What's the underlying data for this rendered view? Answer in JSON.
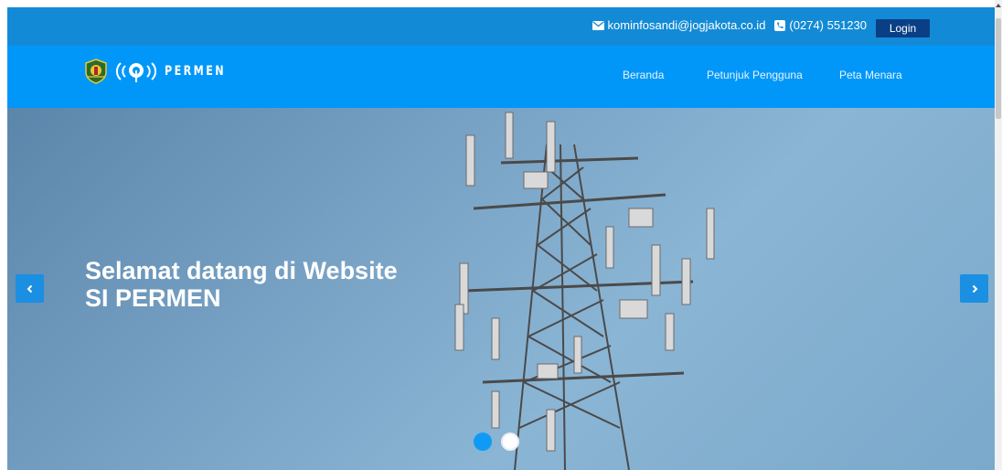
{
  "topbar": {
    "email": "kominfosandi@jogjakota.co.id",
    "phone": "(0274) 551230",
    "login_label": "Login"
  },
  "navbar": {
    "brand": "PERMEN",
    "items": [
      {
        "label": "Beranda"
      },
      {
        "label": "Petunjuk Pengguna"
      },
      {
        "label": "Peta Menara"
      }
    ]
  },
  "hero": {
    "title_line1": "Selamat datang di Website",
    "title_line2": "SI PERMEN"
  },
  "carousel": {
    "slide_count": 2,
    "active_index": 0
  },
  "colors": {
    "topbar": "#138ad6",
    "navbar": "#0197f9",
    "login": "#0a3f86",
    "arrow": "#1b8fe2"
  },
  "icons": {
    "email": "envelope-icon",
    "phone": "phone-icon",
    "prev": "chevron-left-icon",
    "next": "chevron-right-icon"
  }
}
